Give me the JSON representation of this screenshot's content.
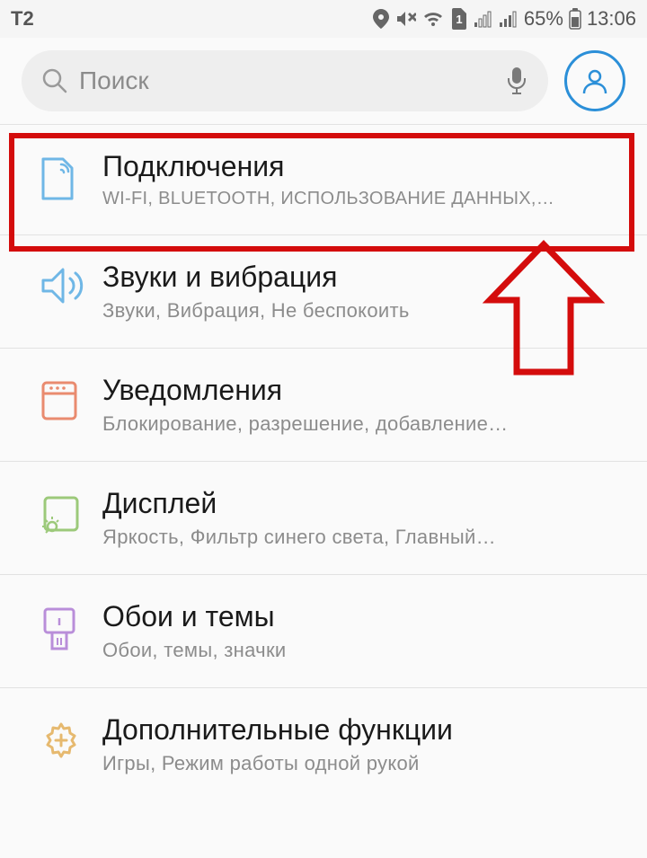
{
  "statusbar": {
    "carrier": "T2",
    "battery_pct": "65%",
    "time": "13:06",
    "sim_label": "1"
  },
  "search": {
    "placeholder": "Поиск"
  },
  "items": [
    {
      "title": "Подключения",
      "sub": "WI-FI, BLUETOOTH, Использование данных,…"
    },
    {
      "title": "Звуки и вибрация",
      "sub": "Звуки, Вибрация, Не беспокоить"
    },
    {
      "title": "Уведомления",
      "sub": "Блокирование, разрешение, добавление…"
    },
    {
      "title": "Дисплей",
      "sub": "Яркость, Фильтр синего света, Главный…"
    },
    {
      "title": "Обои и темы",
      "sub": "Обои, темы, значки"
    },
    {
      "title": "Дополнительные функции",
      "sub": "Игры, Режим работы одной рукой"
    }
  ],
  "colors": {
    "highlight": "#d40c0c",
    "accent": "#2b8fd8",
    "icon_connections": "#6fb7e6",
    "icon_sound": "#6fb7e6",
    "icon_notifications": "#e98b6f",
    "icon_display": "#9cc97a",
    "icon_themes": "#b98ed9",
    "icon_advanced": "#e6b96f"
  }
}
